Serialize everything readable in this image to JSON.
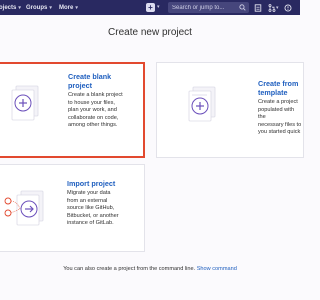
{
  "navbar": {
    "projects_label": "ojects",
    "groups_label": "Groups",
    "more_label": "More",
    "search_placeholder": "Search or jump to..."
  },
  "page": {
    "title": "Create new project"
  },
  "cards": [
    {
      "title_line1": "Create blank",
      "title_line2": "project",
      "desc_lines": [
        "Create a blank project",
        "to house your files,",
        "plan your work, and",
        "collaborate on code,",
        "among other things."
      ],
      "selected": true
    },
    {
      "title_line1": "Create from",
      "title_line2": "template",
      "desc_lines": [
        "Create a project",
        "populated with the",
        "necessary files to",
        "you started quick"
      ]
    },
    {
      "title_line1": "Import project",
      "desc_lines": [
        "Migrate your data",
        "from an external",
        "source like GitHub,",
        "Bitbucket, or another",
        "instance of GitLab."
      ]
    }
  ],
  "footer": {
    "cmd_text": "You can also create a project from the command line.",
    "cmd_link": "Show command"
  },
  "colors": {
    "navbar": "#292961",
    "link": "#1f5fbf",
    "selected_border": "#e2492f",
    "illustration_accent": "#6b4fbb"
  }
}
